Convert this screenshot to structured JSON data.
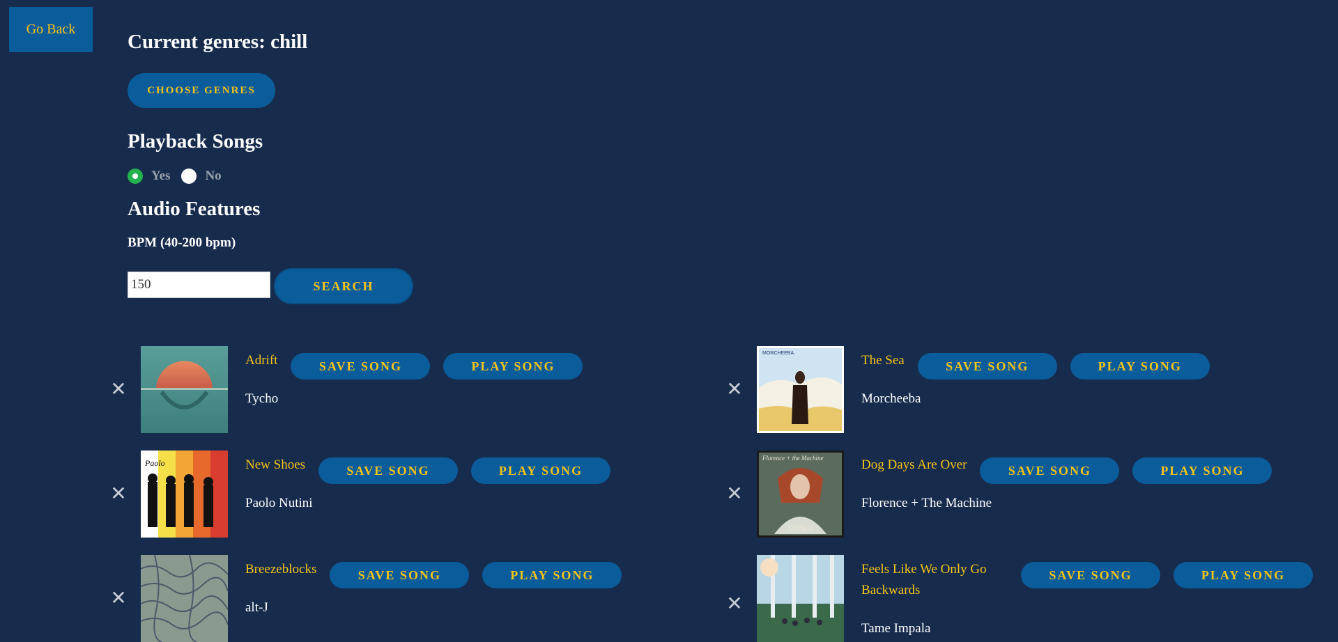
{
  "nav": {
    "go_back_label": "Go Back"
  },
  "header": {
    "current_genres": "Current genres: chill",
    "choose_genres_label": "CHOOSE GENRES"
  },
  "playback": {
    "title": "Playback Songs",
    "options": [
      {
        "label": "Yes",
        "checked": true
      },
      {
        "label": "No",
        "checked": false
      }
    ]
  },
  "audio": {
    "title": "Audio Features",
    "bpm_label": "BPM (40-200 bpm)",
    "bpm_value": "150",
    "search_label": "SEARCH"
  },
  "song_buttons": {
    "save_label": "SAVE SONG",
    "play_label": "PLAY SONG"
  },
  "songs": [
    {
      "title": "Adrift",
      "artist": "Tycho",
      "cover_icon": "tycho-album-cover"
    },
    {
      "title": "The Sea",
      "artist": "Morcheeba",
      "cover_icon": "morcheeba-album-cover"
    },
    {
      "title": "New Shoes",
      "artist": "Paolo Nutini",
      "cover_icon": "paolo-nutini-album-cover"
    },
    {
      "title": "Dog Days Are Over",
      "artist": "Florence + The Machine",
      "cover_icon": "florence-album-cover"
    },
    {
      "title": "Breezeblocks",
      "artist": "alt-J",
      "cover_icon": "alt-j-album-cover"
    },
    {
      "title": "Feels Like We Only Go Backwards",
      "artist": "Tame Impala",
      "cover_icon": "tame-impala-album-cover"
    }
  ],
  "colors": {
    "background": "#172b4d",
    "button": "#0a5c9a",
    "accent": "#f5c518",
    "radio_checked": "#22b14c"
  }
}
